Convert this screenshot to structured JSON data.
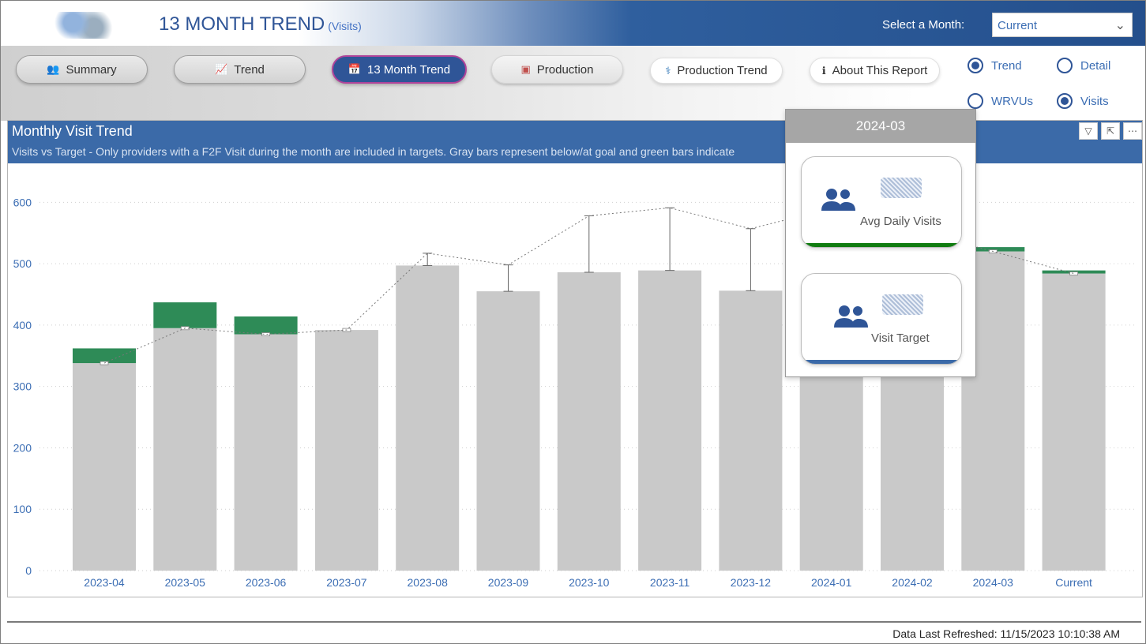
{
  "header": {
    "title": "13 MONTH TREND",
    "title_sub": "(Visits)",
    "month_label": "Select a Month:",
    "month_value": "Current"
  },
  "nav": {
    "summary": "Summary",
    "trend": "Trend",
    "thirteen_month": "13 Month Trend",
    "production": "Production",
    "production_trend": "Production Trend",
    "about": "About This Report"
  },
  "options": {
    "trend": "Trend",
    "detail": "Detail",
    "wrvus": "WRVUs",
    "visits": "Visits",
    "selected_view": "Trend",
    "selected_metric": "Visits"
  },
  "visual": {
    "title": "Monthly Visit Trend",
    "subtitle": "Visits vs Target - Only providers with a F2F Visit during the month are included in targets. Gray bars represent below/at goal and green bars indicate"
  },
  "tooltip": {
    "month": "2024-03",
    "kpi1_label": "Avg Daily Visits",
    "kpi2_label": "Visit Target"
  },
  "footer": {
    "refresh": "Data Last Refreshed: 11/15/2023 10:10:38 AM"
  },
  "colors": {
    "below_goal": "#c9c9c9",
    "above_goal": "#2e8b57",
    "header_blue": "#2f5597",
    "visual_header": "#3b6aa8"
  },
  "chart_data": {
    "type": "bar",
    "categories": [
      "2023-04",
      "2023-05",
      "2023-06",
      "2023-07",
      "2023-08",
      "2023-09",
      "2023-10",
      "2023-11",
      "2023-12",
      "2024-01",
      "2024-02",
      "2024-03",
      "Current"
    ],
    "series": [
      {
        "values": [
          338,
          395,
          385,
          392,
          497,
          455,
          486,
          489,
          456,
          340,
          340,
          520,
          484
        ]
      },
      {
        "values": [
          24,
          42,
          29,
          0,
          0,
          0,
          0,
          0,
          0,
          0,
          0,
          7,
          5
        ]
      },
      {
        "values": [
          338,
          395,
          385,
          392,
          517,
          498,
          578,
          591,
          557,
          590,
          555,
          520,
          484
        ]
      }
    ],
    "ylim": [
      0,
      650
    ],
    "yticks": [
      0,
      100,
      200,
      300,
      400,
      500,
      600
    ],
    "grid": true
  }
}
